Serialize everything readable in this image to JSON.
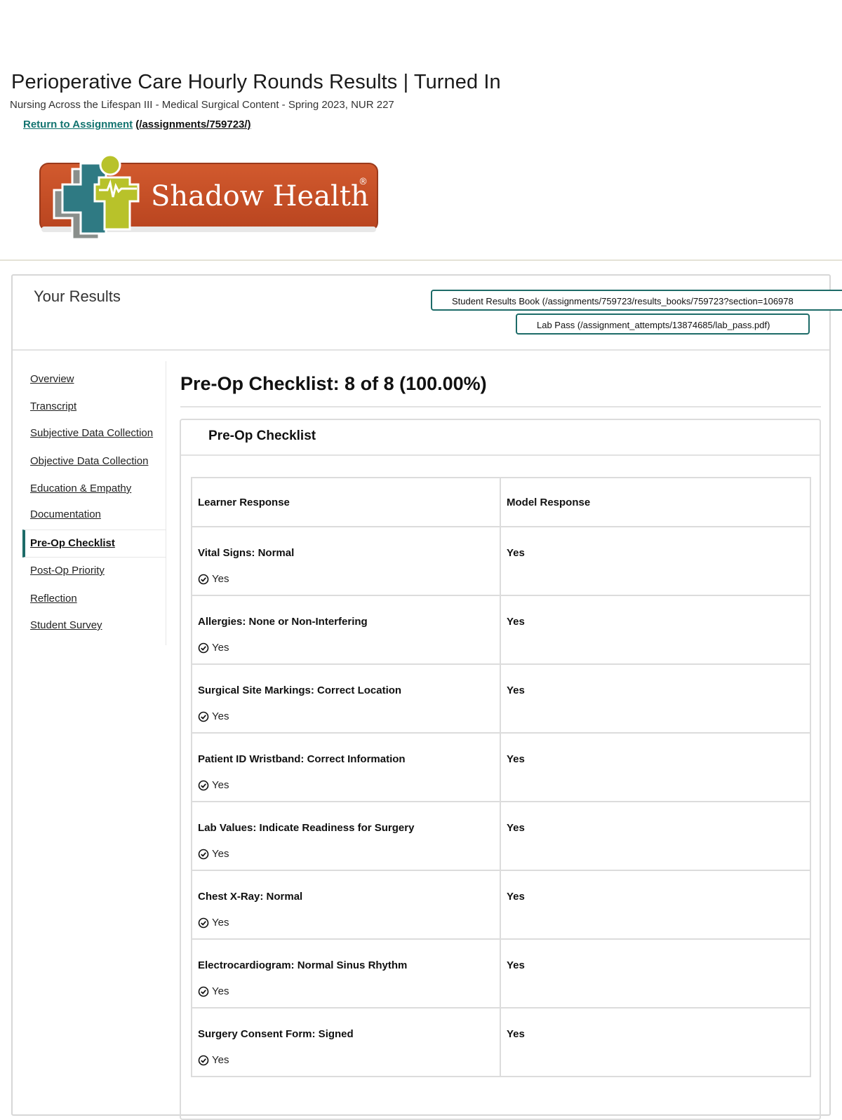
{
  "header": {
    "title": "Perioperative Care Hourly Rounds Results | Turned In",
    "course": "Nursing Across the Lifespan III - Medical Surgical Content - Spring 2023, NUR 227",
    "return_link": "Return to Assignment",
    "return_path": "(/assignments/759723/)"
  },
  "logo": {
    "text": "Shadow Health",
    "mark": "®"
  },
  "results": {
    "heading": "Your Results",
    "results_book_button": "Student Results Book (/assignments/759723/results_books/759723?section=106978",
    "lab_pass_button": "Lab Pass (/assignment_attempts/13874685/lab_pass.pdf)"
  },
  "sidebar": {
    "items": [
      {
        "label": "Overview"
      },
      {
        "label": "Transcript"
      },
      {
        "label": "Subjective Data Collection"
      },
      {
        "label": "Objective Data Collection"
      },
      {
        "label": "Education & Empathy"
      },
      {
        "label": "Documentation"
      },
      {
        "label": "Pre-Op Checklist"
      },
      {
        "label": "Post-Op Priority"
      },
      {
        "label": "Reflection"
      },
      {
        "label": "Student Survey"
      }
    ],
    "active": "Pre-Op Checklist"
  },
  "main": {
    "section_title": "Pre-Op Checklist: 8 of 8 (100.00%)",
    "card_title": "Pre-Op Checklist",
    "columns": [
      "Learner Response",
      "Model Response"
    ],
    "rows": [
      {
        "item": "Vital Signs: Normal",
        "learner": "Yes",
        "model": "Yes"
      },
      {
        "item": "Allergies: None or Non-Interfering",
        "learner": "Yes",
        "model": "Yes"
      },
      {
        "item": "Surgical Site Markings: Correct Location",
        "learner": "Yes",
        "model": "Yes"
      },
      {
        "item": "Patient ID Wristband: Correct Information",
        "learner": "Yes",
        "model": "Yes"
      },
      {
        "item": "Lab Values: Indicate Readiness for Surgery",
        "learner": "Yes",
        "model": "Yes"
      },
      {
        "item": "Chest X-Ray: Normal",
        "learner": "Yes",
        "model": "Yes"
      },
      {
        "item": "Electrocardiogram: Normal Sinus Rhythm",
        "learner": "Yes",
        "model": "Yes"
      },
      {
        "item": "Surgery Consent Form: Signed",
        "learner": "Yes",
        "model": "Yes"
      }
    ]
  },
  "colors": {
    "accent": "#1d6b68",
    "link": "#12736f",
    "logo_orange": "#c9502a",
    "logo_green": "#b8c22a"
  }
}
